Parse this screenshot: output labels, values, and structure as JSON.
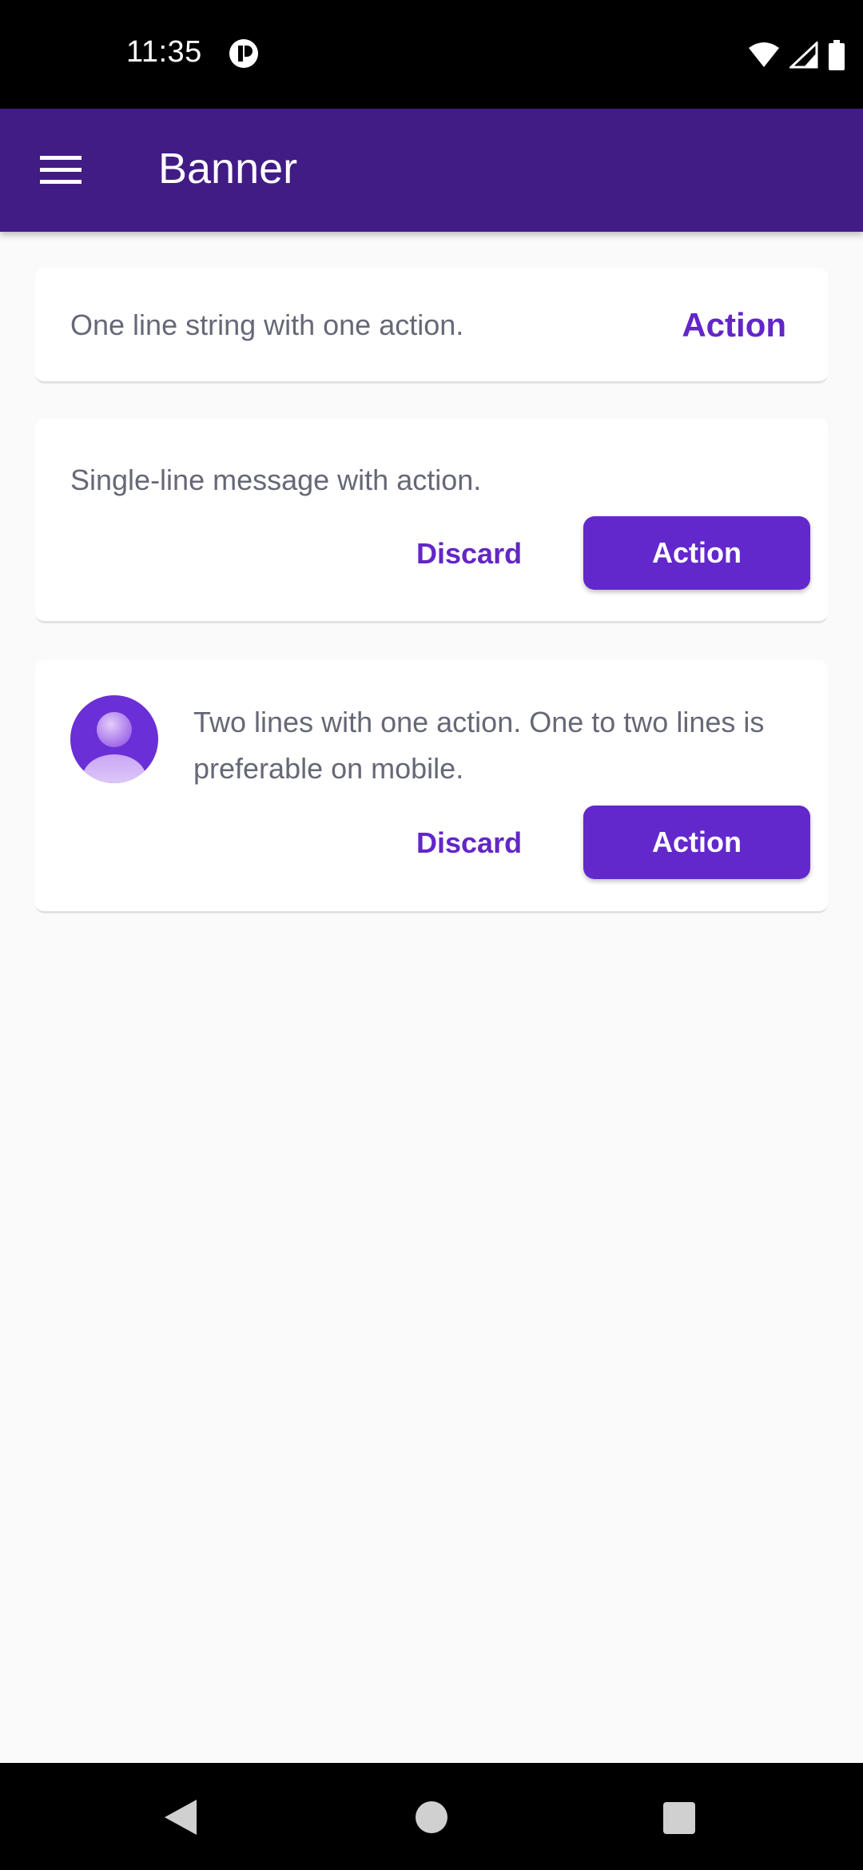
{
  "status_bar": {
    "time": "11:35",
    "icons": [
      "app-notification-icon",
      "wifi-icon",
      "signal-icon",
      "battery-icon"
    ]
  },
  "app_bar": {
    "title": "Banner",
    "menu_icon": "hamburger-menu-icon",
    "background": "#421c85"
  },
  "banners": [
    {
      "text": "One line string with one action.",
      "action_label": "Action"
    },
    {
      "text": "Single-line message with action.",
      "discard_label": "Discard",
      "action_label": "Action"
    },
    {
      "text_line1": "Two lines with one action. One to two lines is",
      "text_line2": "preferable on mobile.",
      "avatar_icon": "person-avatar-icon",
      "discard_label": "Discard",
      "action_label": "Action"
    }
  ],
  "nav_bar": {
    "icons": [
      "back-icon",
      "home-icon",
      "recents-icon"
    ]
  },
  "colors": {
    "accent": "#6326c7",
    "button_fill": "#6328cc",
    "body_text": "#666877",
    "background": "#fafafa"
  }
}
